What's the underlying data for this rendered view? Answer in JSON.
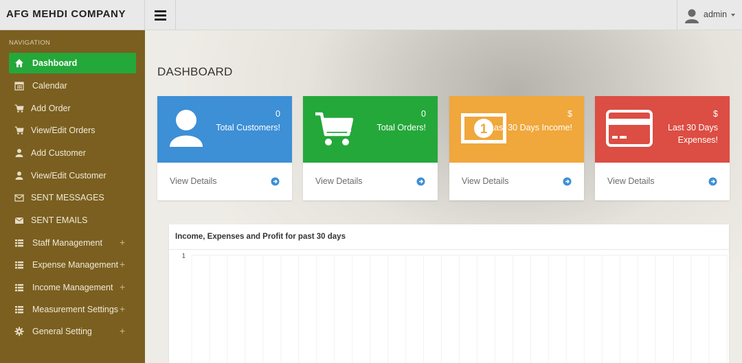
{
  "header": {
    "brand": "AFG MEHDI COMPANY",
    "user": "admin"
  },
  "sidebar": {
    "section_label": "NAVIGATION",
    "items": [
      {
        "label": "Dashboard",
        "icon": "home-icon",
        "active": true
      },
      {
        "label": "Calendar",
        "icon": "calendar-icon"
      },
      {
        "label": "Add Order",
        "icon": "cart-icon"
      },
      {
        "label": "View/Edit Orders",
        "icon": "cart-icon"
      },
      {
        "label": "Add Customer",
        "icon": "user-icon"
      },
      {
        "label": "View/Edit Customer",
        "icon": "user-icon"
      },
      {
        "label": "SENT MESSAGES",
        "icon": "envelope-outline-icon"
      },
      {
        "label": "SENT EMAILS",
        "icon": "envelope-icon"
      },
      {
        "label": "Staff Management",
        "icon": "list-icon",
        "expand": "+"
      },
      {
        "label": "Expense Management",
        "icon": "list-icon",
        "expand": "+"
      },
      {
        "label": "Income Management",
        "icon": "list-icon",
        "expand": "+"
      },
      {
        "label": "Measurement Settings",
        "icon": "list-icon",
        "expand": "+"
      },
      {
        "label": "General Setting",
        "icon": "gear-icon",
        "expand": "+"
      }
    ]
  },
  "main": {
    "title": "DASHBOARD",
    "cards": [
      {
        "value": "0",
        "label": "Total Customers!",
        "link": "View Details",
        "color": "#3d8fd6",
        "icon": "user-icon"
      },
      {
        "value": "0",
        "label": "Total Orders!",
        "link": "View Details",
        "color": "#24a83a",
        "icon": "cart-icon"
      },
      {
        "value": "$",
        "label": "Last 30 Days Income!",
        "link": "View Details",
        "color": "#f0a73b",
        "icon": "banknote-icon"
      },
      {
        "value": "$",
        "label_line1": "Last 30 Days",
        "label_line2": "Expenses!",
        "link": "View Details",
        "color": "#dc4d43",
        "icon": "credit-card-icon"
      }
    ],
    "panel": {
      "title": "Income, Expenses and Profit for past 30 days"
    }
  },
  "chart_data": {
    "type": "line",
    "title": "Income, Expenses and Profit for past 30 days",
    "ytick_labels": [
      "1"
    ],
    "series": [],
    "grid": true
  },
  "colors": {
    "sidebar_bg": "#7a5f20",
    "active_item": "#24a83a",
    "topbar_bg": "#e9e9e9"
  }
}
